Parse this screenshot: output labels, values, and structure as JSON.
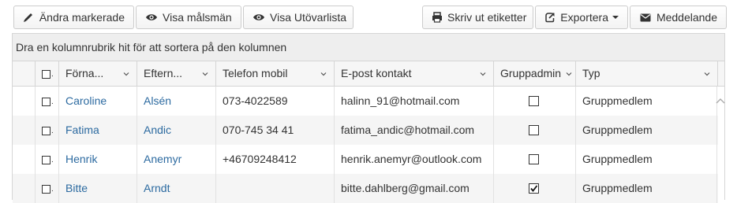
{
  "toolbar": {
    "edit_selected": "Ändra markerade",
    "show_guardians": "Visa målsmän",
    "show_practitioners": "Visa Utövarlista",
    "print_labels": "Skriv ut etiketter",
    "export": "Exportera",
    "message": "Meddelande"
  },
  "grid": {
    "group_hint": "Dra en kolumnrubrik hit för att sortera på den kolumnen",
    "columns": {
      "first_name": "Förna...",
      "last_name": "Eftern...",
      "phone": "Telefon mobil",
      "email": "E-post kontakt",
      "group_admin": "Gruppadmin",
      "type": "Typ"
    },
    "rows": [
      {
        "first_name": "Caroline",
        "last_name": "Alsén",
        "phone": "073-4022589",
        "email": "halinn_91@hotmail.com",
        "group_admin": false,
        "type": "Gruppmedlem"
      },
      {
        "first_name": "Fatima",
        "last_name": "Andic",
        "phone": "070-745 34 41",
        "email": "fatima_andic@hotmail.com",
        "group_admin": false,
        "type": "Gruppmedlem"
      },
      {
        "first_name": "Henrik",
        "last_name": "Anemyr",
        "phone": "+46709248412",
        "email": "henrik.anemyr@outlook.com",
        "group_admin": false,
        "type": "Gruppmedlem"
      },
      {
        "first_name": "Bitte",
        "last_name": "Arndt",
        "phone": "",
        "email": "bitte.dahlberg@gmail.com",
        "group_admin": true,
        "type": "Gruppmedlem"
      }
    ]
  },
  "colors": {
    "link": "#2c6aa0",
    "alt_row": "#f5f5f5",
    "header_bg": "#f6f6f6",
    "border": "#d5d5d5"
  }
}
